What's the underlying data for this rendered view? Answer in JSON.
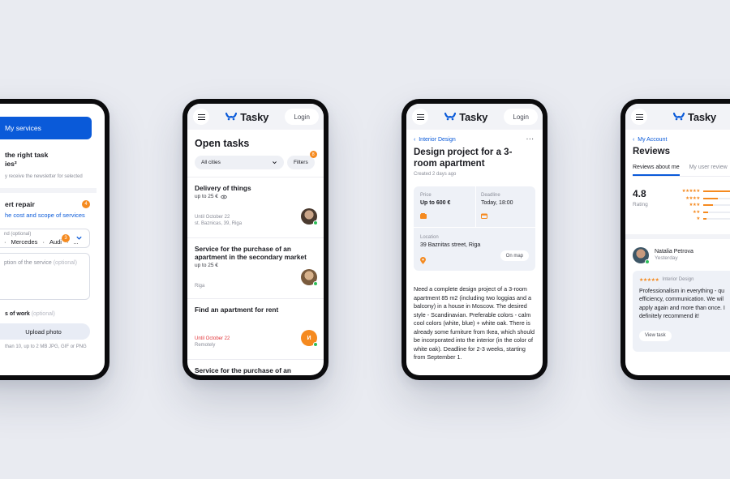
{
  "brand": {
    "name": "Tasky",
    "accent": "#0a5ad9",
    "orange": "#f58a1f"
  },
  "common": {
    "login_label": "Login"
  },
  "phone1": {
    "blue_button": "My services",
    "heading": "the right task\nies²",
    "subtext": "y receive the newsletter for selected",
    "section_title": "ert repair",
    "section_badge": "4",
    "link": "he cost and scope of services",
    "brand_label": "nd (optional)",
    "brand_values": [
      "Mercedes",
      "Audi",
      "..."
    ],
    "brand_badge": "3",
    "desc_placeholder": "ption of the service",
    "desc_optional": "(optional)",
    "photos_label": "s of work",
    "photos_optional": "(optional)",
    "upload_label": "Upload photo",
    "upload_hint": "than 10, up to 2 MB JPG, GIF or PNG"
  },
  "phone2": {
    "title": "Open tasks",
    "city_select": "All cities",
    "filters_label": "Filters",
    "filters_badge": "8",
    "tasks": [
      {
        "title": "Delivery of things",
        "price": "up to 25 €",
        "date": "Until October 22",
        "address": "st. Baznicas, 39, Riga"
      },
      {
        "title": "Service for the purchase of an apartment in the secondary market",
        "price": "up to 25 €",
        "date": "",
        "address": "Riga"
      },
      {
        "title": "Find an apartment for rent",
        "price": "",
        "date": "Until October 22",
        "address": "Remotely",
        "avatar_initial": "И"
      },
      {
        "title": "Service for the purchase of an"
      }
    ]
  },
  "phone3": {
    "breadcrumb": "Interior Design",
    "title": "Design project for a 3-room apartment",
    "created": "Created 2 days ago",
    "price_label": "Price",
    "price_value": "Up to 600 €",
    "deadline_label": "Deadline",
    "deadline_value": "Today, 18:00",
    "location_label": "Location",
    "location_value": "39 Baznitas street, Riga",
    "on_map": "On map",
    "description": "Need a complete design project of a 3-room apartment 85 m2 (including two loggias and a balcony) in a house in Moscow. The desired style - Scandinavian. Preferable colors - calm cool colors (white, blue) + white oak. There is already some furniture from Ikea, which should be incorporated into the interior (in the color of white oak). Deadline for 2-3 weeks, starting from September 1."
  },
  "phone4": {
    "breadcrumb": "My Account",
    "title": "Reviews",
    "tab_active": "Reviews about me",
    "tab_inactive": "My user review",
    "score": "4.8",
    "score_label": "Rating",
    "bars": [
      {
        "stars": "★★★★★",
        "fraction": 0.9
      },
      {
        "stars": "★★★★",
        "fraction": 0.45
      },
      {
        "stars": "★★★",
        "fraction": 0.3
      },
      {
        "stars": "★★",
        "fraction": 0.15
      },
      {
        "stars": "★",
        "fraction": 0.1
      }
    ],
    "reviewer_name": "Natalia Petrova",
    "reviewer_when": "Yesterday",
    "review_stars": "★★★★★",
    "review_category": "Interior Design",
    "review_text": "Professionalism in everything - qu\nefficiency, communication. We wil\napply again and more than once. I\ndefinitely recommend it!",
    "view_task": "View task"
  }
}
